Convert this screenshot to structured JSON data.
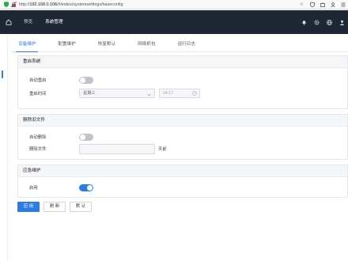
{
  "browser": {
    "url_host": "192.168.0.106",
    "url_prefix": "http://",
    "url_path": "/#/index/systemsettings/baseconfig"
  },
  "topnav": {
    "items": [
      {
        "label": "预览"
      },
      {
        "label": "系统管理"
      }
    ]
  },
  "tabs": [
    {
      "label": "设备维护"
    },
    {
      "label": "配置维护"
    },
    {
      "label": "恢复默认"
    },
    {
      "label": "网络抓包"
    },
    {
      "label": "运行日志"
    }
  ],
  "reboot": {
    "title": "重启系统",
    "auto_label": "自动重启",
    "time_label": "重启时间",
    "day_value": "星期三",
    "time_placeholder": "04:17"
  },
  "delete_old": {
    "title": "删除旧文件",
    "auto_label": "自动删除",
    "files_label": "删除文件",
    "unit": "天前"
  },
  "emergency": {
    "title": "应急维护",
    "enable_label": "启用"
  },
  "buttons": {
    "apply": "应 用",
    "refresh": "刷 新",
    "default": "默 认"
  },
  "colors": {
    "accent": "#2d7be5",
    "topnav_bg": "#1f2634"
  }
}
